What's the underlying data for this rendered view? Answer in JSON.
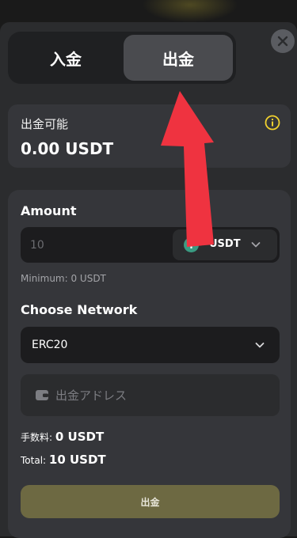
{
  "tabs": [
    {
      "label": "入金",
      "active": false
    },
    {
      "label": "出金",
      "active": true
    }
  ],
  "balance": {
    "label": "出金可能",
    "value": "0.00 USDT"
  },
  "form": {
    "amount_label": "Amount",
    "amount_placeholder": "10",
    "currency": "USDT",
    "minimum_text": "Minimum: 0 USDT",
    "network_label": "Choose Network",
    "network_value": "ERC20",
    "address_placeholder": "出金アドレス",
    "fee_label": "手数料:",
    "fee_value": "0 USDT",
    "total_label": "Total:",
    "total_value": "10 USDT",
    "submit_label": "出金"
  },
  "icons": {
    "close": "close-icon",
    "info": "info-icon",
    "coin": "tether-coin-icon",
    "chevron": "chevron-down-icon",
    "wallet": "wallet-icon"
  },
  "colors": {
    "accent_info": "#f2d22e",
    "submit_bg": "#6d6942",
    "coin": "#3a9b82",
    "arrow": "#ef3340"
  }
}
